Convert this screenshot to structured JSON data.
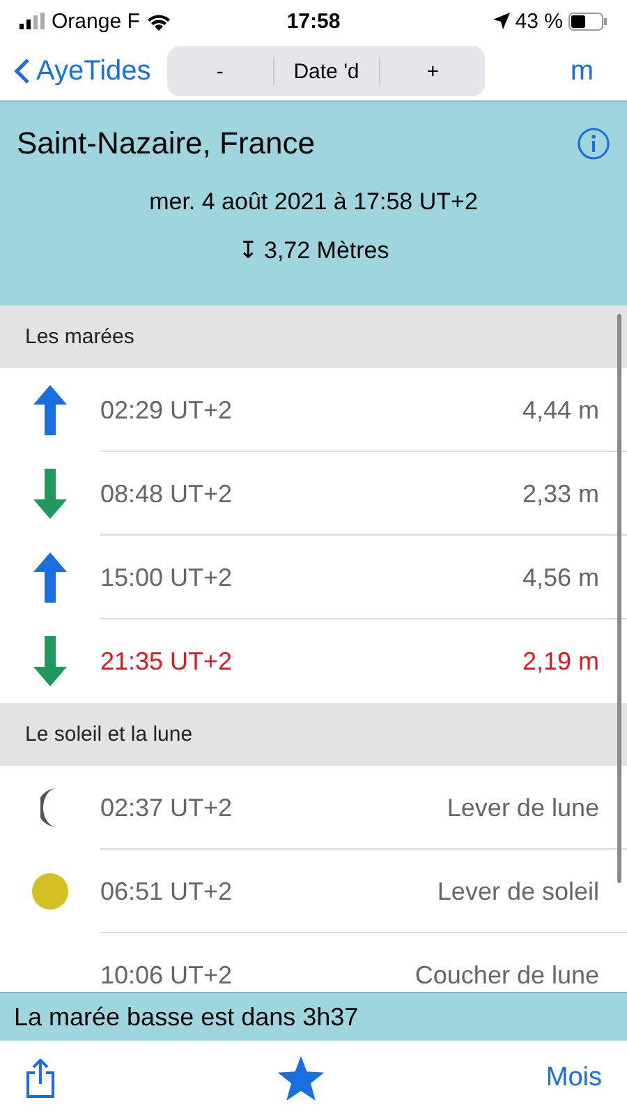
{
  "status_bar": {
    "carrier": "Orange F",
    "time": "17:58",
    "battery": "43 %"
  },
  "nav": {
    "back": "AyeTides",
    "segments": [
      {
        "label": "-"
      },
      {
        "label": "Date 'd"
      },
      {
        "label": "+"
      }
    ],
    "right": "m"
  },
  "header": {
    "location": "Saint-Nazaire, France",
    "datetime": "mer. 4 août 2021 à 17:58 UT+2",
    "height_symbol": "↧",
    "height": "3,72 Mètres"
  },
  "sections": [
    {
      "title": "Les marées",
      "rows": [
        {
          "kind": "rising",
          "time": "02:29 UT+2",
          "value": "4,44 m",
          "highlighted": false
        },
        {
          "kind": "falling",
          "time": "08:48 UT+2",
          "value": "2,33 m",
          "highlighted": false
        },
        {
          "kind": "rising",
          "time": "15:00 UT+2",
          "value": "4,56 m",
          "highlighted": false
        },
        {
          "kind": "falling",
          "time": "21:35 UT+2",
          "value": "2,19 m",
          "highlighted": true
        }
      ]
    },
    {
      "title": "Le soleil et la lune",
      "rows": [
        {
          "kind": "moon",
          "time": "02:37 UT+2",
          "value": "Lever de lune",
          "highlighted": false
        },
        {
          "kind": "sun",
          "time": "06:51 UT+2",
          "value": "Lever de soleil",
          "highlighted": false
        },
        {
          "kind": "none",
          "time": "10:06 UT+2",
          "value": "Coucher de lune",
          "highlighted": false
        }
      ]
    }
  ],
  "banner": "La marée basse est dans 3h37",
  "toolbar": {
    "right": "Mois"
  }
}
